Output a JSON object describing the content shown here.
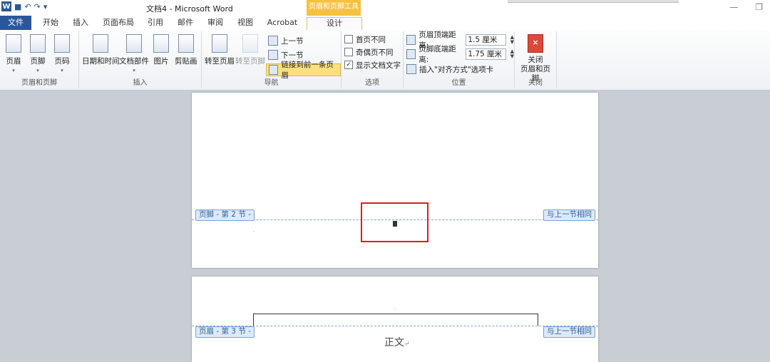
{
  "window": {
    "title": "文档4 - Microsoft Word",
    "context_tab": "页眉和页脚工具"
  },
  "tabs": [
    "文件",
    "开始",
    "插入",
    "页面布局",
    "引用",
    "邮件",
    "审阅",
    "视图",
    "Acrobat",
    "设计"
  ],
  "groups": {
    "header_footer": {
      "label": "页眉和页脚",
      "buttons": [
        "页眉",
        "页脚",
        "页码"
      ]
    },
    "insert": {
      "label": "插入",
      "buttons": [
        "日期和时间",
        "文档部件",
        "图片",
        "剪贴画"
      ]
    },
    "nav": {
      "label": "导航",
      "goto_header": "转至页眉",
      "goto_footer": "转至页脚",
      "prev": "上一节",
      "next": "下一节",
      "link_prev": "链接到前一条页眉"
    },
    "options": {
      "label": "选项",
      "first_page": "首页不同",
      "odd_even": "奇偶页不同",
      "show_text": "显示文档文字"
    },
    "position": {
      "label": "位置",
      "header_dist_label": "页眉顶端距离:",
      "header_dist": "1.5 厘米",
      "footer_dist_label": "页脚底端距离:",
      "footer_dist": "1.75 厘米",
      "insert_tab": "插入\"对齐方式\"选项卡"
    },
    "close": {
      "label": "关闭",
      "button": "关闭\n页眉和页脚"
    }
  },
  "doc": {
    "footer_tag": "页脚 - 第 2 节 -",
    "same_as_prev": "与上一节相同",
    "header_tag": "页眉 - 第 3 节 -",
    "body_text": "正文",
    "para_mark": "↵",
    "small_mark": "·",
    "page_number": "2",
    "colors": {
      "accent": "#2b579a",
      "highlight": "#e21b1b",
      "context": "#f5c240"
    }
  }
}
